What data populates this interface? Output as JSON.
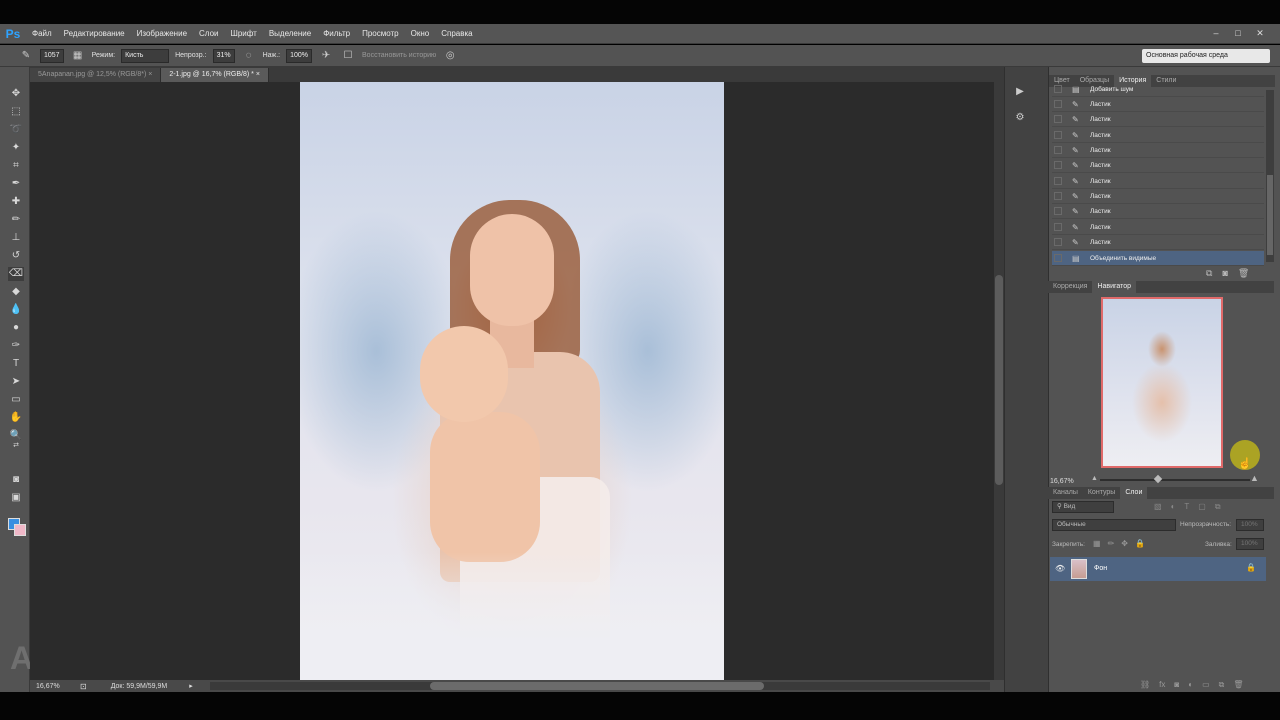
{
  "app": {
    "logo": "Ps",
    "menu": [
      "Файл",
      "Редактирование",
      "Изображение",
      "Слои",
      "Шрифт",
      "Выделение",
      "Фильтр",
      "Просмотр",
      "Окно",
      "Справка"
    ],
    "window_controls": [
      "–",
      "□",
      "✕"
    ]
  },
  "options_bar": {
    "brush_size": "1057",
    "mode_label": "Режим:",
    "mode_value": "Кисть",
    "opacity_label": "Непрозр.:",
    "opacity_value": "31%",
    "flow_label": "Наж.:",
    "flow_value": "100%",
    "restore_history_label": "Восстановить историю",
    "workspace": "Основная рабочая среда"
  },
  "tabs": [
    {
      "label": "5Anapanan.jpg @ 12,5% (RGB/8*)",
      "active": false
    },
    {
      "label": "2-1.jpg @ 16,7% (RGB/8) *",
      "active": true
    }
  ],
  "status": {
    "zoom": "16,67%",
    "doc_info": "Док: 59,9M/59,9M"
  },
  "history_panel": {
    "tabs": [
      "Цвет",
      "Образцы",
      "История",
      "Стили"
    ],
    "active_tab": "История",
    "items": [
      "Добавить шум",
      "Ластик",
      "Ластик",
      "Ластик",
      "Ластик",
      "Ластик",
      "Ластик",
      "Ластик",
      "Ластик",
      "Ластик",
      "Ластик",
      "Объединить видимые"
    ],
    "selected_index": 11
  },
  "navigator_panel": {
    "tabs": [
      "Коррекция",
      "Навигатор"
    ],
    "active_tab": "Навигатор",
    "zoom": "16,67%"
  },
  "layers_panel": {
    "tabs": [
      "Каналы",
      "Контуры",
      "Слои"
    ],
    "active_tab": "Слои",
    "filter_kind": "Вид",
    "blend_mode": "Обычные",
    "opacity_label": "Непрозрачность:",
    "opacity_value": "100%",
    "lock_label": "Закрепить:",
    "fill_label": "Заливка:",
    "fill_value": "100%",
    "layers": [
      {
        "name": "Фон",
        "visible": true,
        "locked": true
      }
    ]
  },
  "colors": {
    "foreground": "#3a8fe0",
    "background": "#f0b8c8",
    "selection": "#4e6482"
  }
}
